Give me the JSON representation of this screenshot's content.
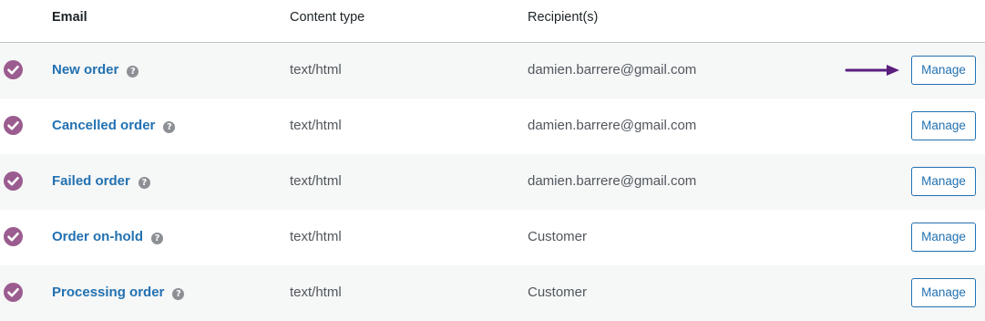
{
  "header": {
    "email": "Email",
    "content_type": "Content type",
    "recipients": "Recipient(s)"
  },
  "rows": [
    {
      "name": "New order",
      "content_type": "text/html",
      "recipient": "damien.barrere@gmail.com",
      "action": "Manage"
    },
    {
      "name": "Cancelled order",
      "content_type": "text/html",
      "recipient": "damien.barrere@gmail.com",
      "action": "Manage"
    },
    {
      "name": "Failed order",
      "content_type": "text/html",
      "recipient": "damien.barrere@gmail.com",
      "action": "Manage"
    },
    {
      "name": "Order on-hold",
      "content_type": "text/html",
      "recipient": "Customer",
      "action": "Manage"
    },
    {
      "name": "Processing order",
      "content_type": "text/html",
      "recipient": "Customer",
      "action": "Manage"
    }
  ],
  "icons": {
    "status": "check-circle-icon",
    "help": "question-mark-icon",
    "annotation": "arrow-right-icon"
  },
  "colors": {
    "status_enabled": "#9b5c8f",
    "link": "#2271b1",
    "annotation_arrow": "#5b1f7e"
  }
}
